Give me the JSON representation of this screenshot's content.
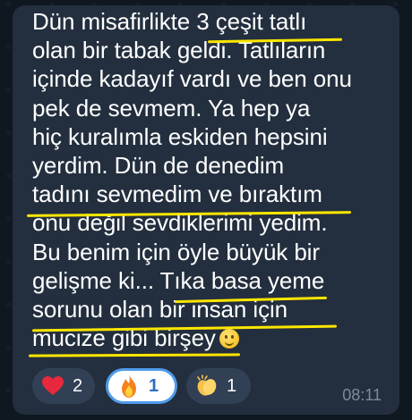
{
  "message": {
    "lines": [
      "Dün misafirlikte 3 çeşit tatlı",
      "olan bir tabak geldi. Tatlıların",
      "içinde kadayıf vardı ve ben onu",
      "pek de sevmem. Ya hep ya",
      "hiç kuralımla eskiden hepsini",
      "yerdim. Dün de denedim",
      "tadını sevmedim ve bıraktım",
      "onu değil sevdiklerimi yedim.",
      "Bu benim için öyle büyük bir",
      "gelişme ki... Tıka basa yeme",
      "sorunu olan bir insan için",
      "mucize gibi birşey"
    ],
    "emoji": "slightly-smiling-face-icon",
    "time": "08:11"
  },
  "reactions": [
    {
      "icon": "red-heart-icon",
      "count": "2",
      "active": false
    },
    {
      "icon": "fire-icon",
      "count": "1",
      "active": true
    },
    {
      "icon": "clapping-hands-icon",
      "count": "1",
      "active": false
    }
  ],
  "colors": {
    "background": "#0e1621",
    "bubble": "#232f3e",
    "highlight": "#ffe600",
    "active_reaction_border": "#4f9bea",
    "time_text": "#7d8b99"
  }
}
